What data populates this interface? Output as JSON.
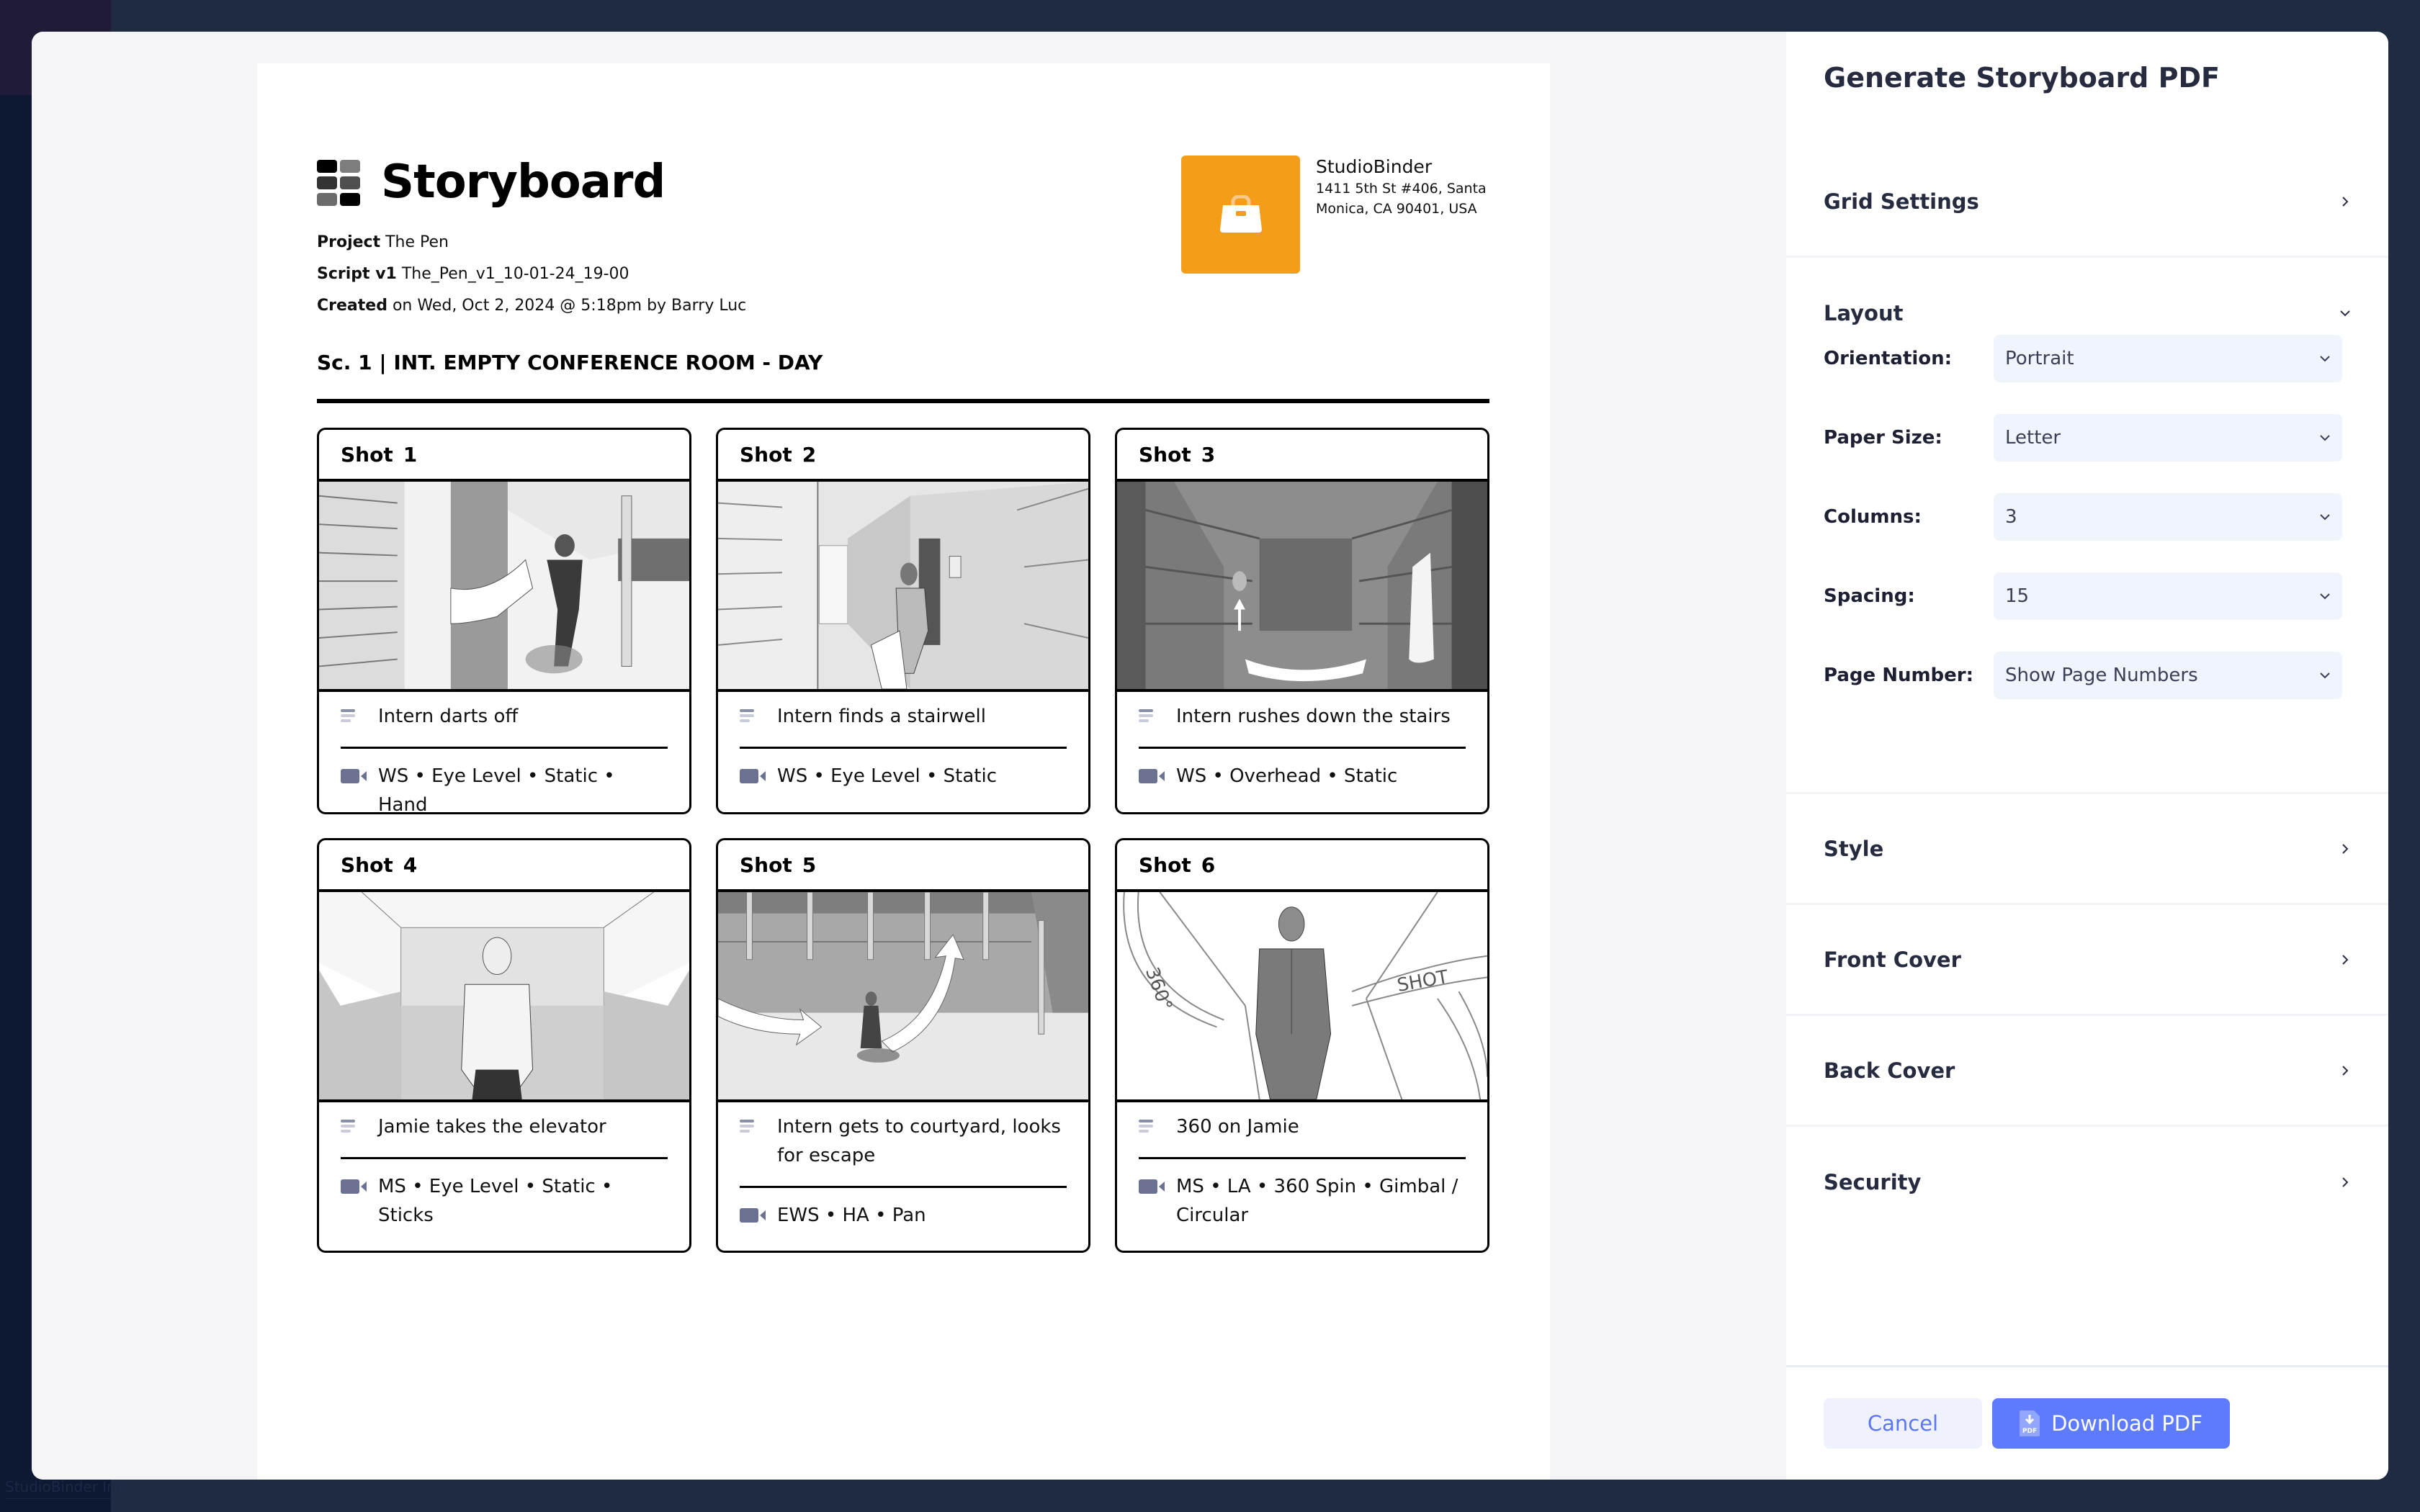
{
  "background": {
    "footer_text": "StudioBinder Inc."
  },
  "colors": {
    "accent": "#5f7bfd",
    "company_logo": "#f49d19",
    "select_bg": "#f0f4fc",
    "icon_gray": "#6b7291"
  },
  "document": {
    "title": "Storyboard",
    "project_label": "Project",
    "project_value": "The Pen",
    "script_label": "Script v1",
    "script_value": "The_Pen_v1_10-01-24_19-00",
    "created_label": "Created",
    "created_value": "on Wed, Oct 2, 2024 @ 5:18pm by Barry Luc",
    "company": {
      "name": "StudioBinder",
      "address": "1411 5th St #406, Santa Monica, CA 90401, USA",
      "logo_icon": "briefcase-icon"
    },
    "scene_heading": "Sc. 1 | INT. EMPTY CONFERENCE ROOM - DAY",
    "shots": [
      {
        "label": "Shot",
        "number": "1",
        "description": "Intern darts off",
        "camera": "WS • Eye Level • Static • Hand",
        "image": "hallway-running-sketch"
      },
      {
        "label": "Shot",
        "number": "2",
        "description": "Intern finds a stairwell",
        "camera": "WS • Eye Level • Static",
        "image": "corridor-door-sketch"
      },
      {
        "label": "Shot",
        "number": "3",
        "description": "Intern rushes down the stairs",
        "camera": "WS • Overhead • Static",
        "image": "stairwell-overhead-sketch"
      },
      {
        "label": "Shot",
        "number": "4",
        "description": "Jamie takes the elevator",
        "camera": "MS • Eye Level • Static • Sticks",
        "image": "elevator-man-sketch"
      },
      {
        "label": "Shot",
        "number": "5",
        "description": "Intern gets to courtyard, looks for escape",
        "camera": "EWS • HA • Pan",
        "image": "courtyard-sketch"
      },
      {
        "label": "Shot",
        "number": "6",
        "description": "360 on Jamie",
        "camera": "MS • LA • 360 Spin • Gimbal / Circular",
        "image": "360-spin-sketch",
        "annotations": [
          "360°",
          "SHOT"
        ]
      }
    ]
  },
  "panel": {
    "title": "Generate Storyboard PDF",
    "sections": {
      "grid_settings": "Grid Settings",
      "layout": "Layout",
      "style": "Style",
      "front_cover": "Front Cover",
      "back_cover": "Back Cover",
      "security": "Security"
    },
    "layout_fields": [
      {
        "label": "Orientation:",
        "value": "Portrait"
      },
      {
        "label": "Paper Size:",
        "value": "Letter"
      },
      {
        "label": "Columns:",
        "value": "3"
      },
      {
        "label": "Spacing:",
        "value": "15"
      },
      {
        "label": "Page Number:",
        "value": "Show Page Numbers"
      }
    ],
    "cancel_label": "Cancel",
    "download_label": "Download PDF",
    "pdf_icon_text": "PDF"
  }
}
